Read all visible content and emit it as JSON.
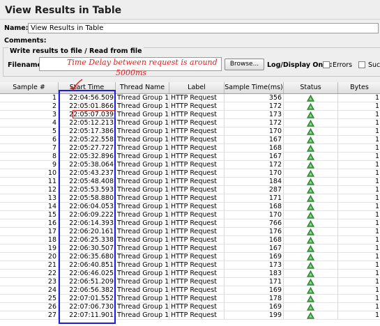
{
  "panel": {
    "title": "View Results in Table",
    "name_label": "Name:",
    "name_value": "View Results in Table",
    "comments_label": "Comments:"
  },
  "file": {
    "legend": "Write results to file / Read from file",
    "filename_label": "Filename",
    "filename_value": "",
    "browse_label": "Browse...",
    "logonly_label": "Log/Display Only:",
    "errors_label": "Errors",
    "success_label": "Suc"
  },
  "table": {
    "columns": [
      "Sample #",
      "Start Time",
      "Thread Name",
      "Label",
      "Sample Time(ms)",
      "Status",
      "Bytes"
    ],
    "rows": [
      [
        "1",
        "22:04:56.509",
        "Thread Group 1-1",
        "HTTP Request",
        "356",
        "success",
        "1"
      ],
      [
        "2",
        "22:05:01.866",
        "Thread Group 1-1",
        "HTTP Request",
        "172",
        "success",
        "1"
      ],
      [
        "3",
        "22:05:07.039",
        "Thread Group 1-1",
        "HTTP Request",
        "173",
        "success",
        "1"
      ],
      [
        "4",
        "22:05:12.213",
        "Thread Group 1-1",
        "HTTP Request",
        "172",
        "success",
        "1"
      ],
      [
        "5",
        "22:05:17.386",
        "Thread Group 1-1",
        "HTTP Request",
        "170",
        "success",
        "1"
      ],
      [
        "6",
        "22:05:22.558",
        "Thread Group 1-1",
        "HTTP Request",
        "167",
        "success",
        "1"
      ],
      [
        "7",
        "22:05:27.727",
        "Thread Group 1-1",
        "HTTP Request",
        "168",
        "success",
        "1"
      ],
      [
        "8",
        "22:05:32.896",
        "Thread Group 1-1",
        "HTTP Request",
        "167",
        "success",
        "1"
      ],
      [
        "9",
        "22:05:38.064",
        "Thread Group 1-1",
        "HTTP Request",
        "172",
        "success",
        "1"
      ],
      [
        "10",
        "22:05:43.237",
        "Thread Group 1-1",
        "HTTP Request",
        "170",
        "success",
        "1"
      ],
      [
        "11",
        "22:05:48.408",
        "Thread Group 1-1",
        "HTTP Request",
        "184",
        "success",
        "1"
      ],
      [
        "12",
        "22:05:53.593",
        "Thread Group 1-1",
        "HTTP Request",
        "287",
        "success",
        "1"
      ],
      [
        "13",
        "22:05:58.880",
        "Thread Group 1-1",
        "HTTP Request",
        "171",
        "success",
        "1"
      ],
      [
        "14",
        "22:06:04.053",
        "Thread Group 1-1",
        "HTTP Request",
        "168",
        "success",
        "1"
      ],
      [
        "15",
        "22:06:09.222",
        "Thread Group 1-1",
        "HTTP Request",
        "170",
        "success",
        "1"
      ],
      [
        "16",
        "22:06:14.393",
        "Thread Group 1-1",
        "HTTP Request",
        "766",
        "success",
        "1"
      ],
      [
        "17",
        "22:06:20.161",
        "Thread Group 1-1",
        "HTTP Request",
        "176",
        "success",
        "1"
      ],
      [
        "18",
        "22:06:25.338",
        "Thread Group 1-1",
        "HTTP Request",
        "168",
        "success",
        "1"
      ],
      [
        "19",
        "22:06:30.507",
        "Thread Group 1-1",
        "HTTP Request",
        "167",
        "success",
        "1"
      ],
      [
        "20",
        "22:06:35.680",
        "Thread Group 1-1",
        "HTTP Request",
        "169",
        "success",
        "1"
      ],
      [
        "21",
        "22:06:40.851",
        "Thread Group 1-1",
        "HTTP Request",
        "173",
        "success",
        "1"
      ],
      [
        "22",
        "22:06:46.025",
        "Thread Group 1-1",
        "HTTP Request",
        "183",
        "success",
        "1"
      ],
      [
        "23",
        "22:06:51.209",
        "Thread Group 1-1",
        "HTTP Request",
        "171",
        "success",
        "1"
      ],
      [
        "24",
        "22:06:56.382",
        "Thread Group 1-1",
        "HTTP Request",
        "169",
        "success",
        "1"
      ],
      [
        "25",
        "22:07:01.552",
        "Thread Group 1-1",
        "HTTP Request",
        "178",
        "success",
        "1"
      ],
      [
        "26",
        "22:07:06.730",
        "Thread Group 1-1",
        "HTTP Request",
        "169",
        "success",
        "1"
      ],
      [
        "27",
        "22:07:11.901",
        "Thread Group 1-1",
        "HTTP Request",
        "199",
        "success",
        "1"
      ]
    ]
  },
  "annotation": {
    "line1": "Time Delay between request is around",
    "line2": "5000ms"
  },
  "colors": {
    "annotation": "#e02020",
    "highlight_column": "#1c1ce0",
    "status_ok": "#3aa040"
  },
  "icons": {
    "status": "success-triangle-icon"
  }
}
